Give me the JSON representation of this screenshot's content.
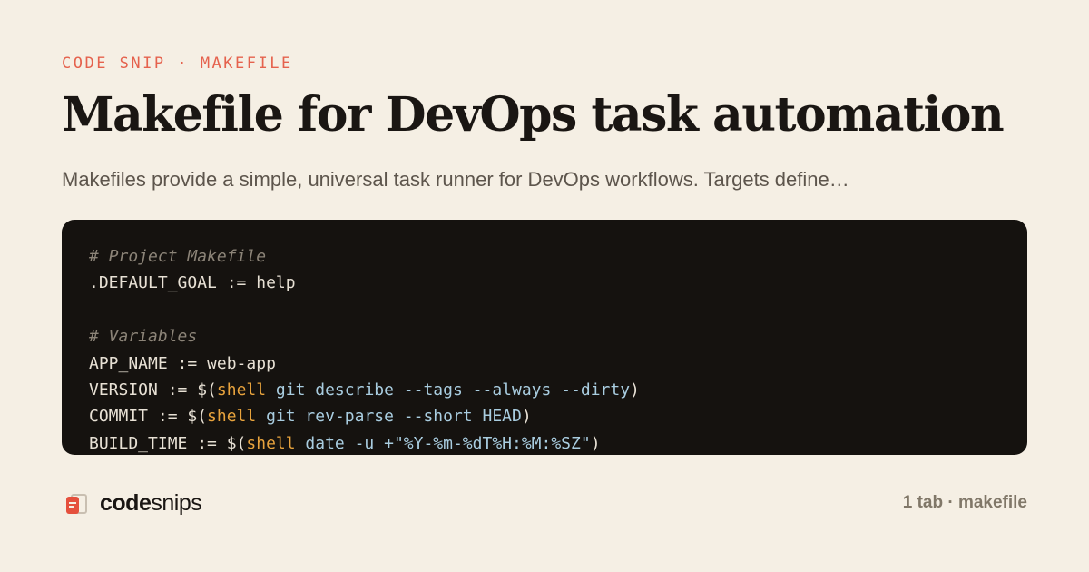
{
  "eyebrow": "CODE SNIP · MAKEFILE",
  "title": "Makefile for DevOps task automation",
  "description": "Makefiles provide a simple, universal task runner for DevOps workflows. Targets define…",
  "code_lines": [
    [
      {
        "t": "# Project Makefile",
        "c": "comment"
      }
    ],
    [
      {
        "t": ".DEFAULT_GOAL := help",
        "c": "plain"
      }
    ],
    [],
    [
      {
        "t": "# Variables",
        "c": "comment"
      }
    ],
    [
      {
        "t": "APP_NAME := web-app",
        "c": "plain"
      }
    ],
    [
      {
        "t": "VERSION := $(",
        "c": "plain"
      },
      {
        "t": "shell",
        "c": "kw"
      },
      {
        "t": " git describe --tags --always --dirty",
        "c": "arg"
      },
      {
        "t": ")",
        "c": "plain"
      }
    ],
    [
      {
        "t": "COMMIT := $(",
        "c": "plain"
      },
      {
        "t": "shell",
        "c": "kw"
      },
      {
        "t": " git rev-parse --short HEAD",
        "c": "arg"
      },
      {
        "t": ")",
        "c": "plain"
      }
    ],
    [
      {
        "t": "BUILD_TIME := $(",
        "c": "plain"
      },
      {
        "t": "shell",
        "c": "kw"
      },
      {
        "t": " date -u +\"%Y-%m-%dT%H:%M:%SZ\"",
        "c": "arg"
      },
      {
        "t": ")",
        "c": "plain"
      }
    ]
  ],
  "footer": {
    "logo_bold": "code",
    "logo_regular": "snips",
    "logo_icon": "stacked-cards-icon",
    "meta": "1 tab · makefile"
  },
  "colors": {
    "accent": "#e5624d",
    "background": "#f5efe4",
    "code_background": "#15120f",
    "keyword": "#e8a33d",
    "argument": "#a9cde0",
    "comment": "#8c8478"
  }
}
